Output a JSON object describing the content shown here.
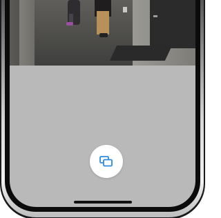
{
  "screen": {
    "camera_feed": {
      "icon": "camera-video-feed"
    },
    "action_button": {
      "icon": "screens-switch-icon",
      "icon_color": "#2a8be0"
    },
    "home_indicator": {}
  },
  "colors": {
    "screen_background": "#b9b9b9",
    "button_background": "#ffffff",
    "accent": "#2a8be0"
  }
}
